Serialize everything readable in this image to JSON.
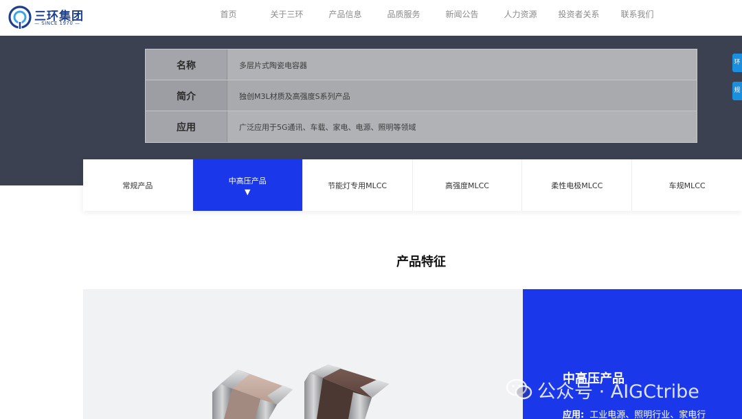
{
  "header": {
    "logo_text": "三环集团",
    "logo_sub": "— SINCE 1970 —",
    "nav": [
      "首页",
      "关于三环",
      "产品信息",
      "品质服务",
      "新闻公告",
      "人力资源",
      "投资者关系",
      "联系我们"
    ]
  },
  "info": {
    "rows": [
      {
        "label": "名称",
        "value": "多层片式陶瓷电容器"
      },
      {
        "label": "简介",
        "value": "独创M3L材质及高强度S系列产品"
      },
      {
        "label": "应用",
        "value": "广泛应用于5G通讯、车载、家电、电源、照明等领域"
      }
    ]
  },
  "side_tabs": [
    "环",
    "规"
  ],
  "categories": {
    "items": [
      "常规产品",
      "中高压产品",
      "节能灯专用MLCC",
      "高强度MLCC",
      "柔性电极MLCC",
      "车规MLCC"
    ],
    "active_index": 1,
    "active_arrow": "▼"
  },
  "section": {
    "title": "产品特征"
  },
  "feature": {
    "title": "中高压产品",
    "app_label": "应用:",
    "app_value": "工业电源、照明行业、家电行"
  },
  "watermark": {
    "text": "公众号 · AIGCtribe"
  },
  "colors": {
    "brand": "#1c3f8f",
    "accent_blue": "#1a37ea",
    "hero_dark": "#3c4151",
    "side_tab_blue": "#1a8fe0"
  }
}
